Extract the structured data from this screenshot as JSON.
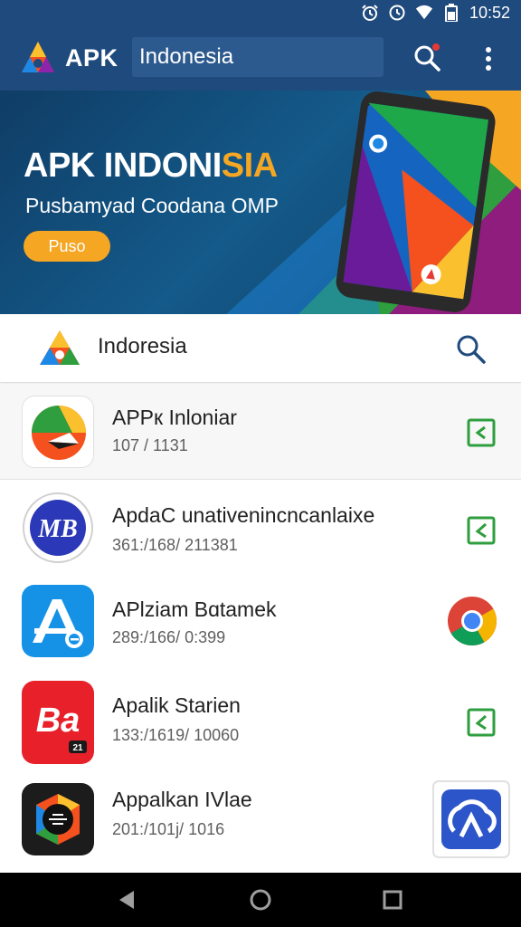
{
  "status_bar": {
    "time": "10:52",
    "icons": [
      "alarm-icon",
      "clock-icon",
      "wifi-icon",
      "battery-icon"
    ]
  },
  "app_bar": {
    "title": "APK",
    "search_text": "Indonesia",
    "actions": [
      "search-icon",
      "more-vert-icon"
    ]
  },
  "banner": {
    "title_main": "APK INDONI",
    "title_highlight": "SIA",
    "subtitle": "Pusbamyad Coodana OMP",
    "button_label": "Puso"
  },
  "section": {
    "title": "Indoresia",
    "action": "search-icon"
  },
  "apps": [
    {
      "name": "APPк Inlonіar",
      "meta": "107 / 1131",
      "icon": "triangle-app-icon",
      "action": "install-check-icon"
    },
    {
      "name": "ApdaC unativenincncanlaixe",
      "meta": "361:/168/ 211381",
      "icon": "mb-app-icon",
      "action": "install-check-icon"
    },
    {
      "name": "APlzіam Bɑtamek",
      "meta": "289:/166/ 0:399",
      "icon": "ae-app-icon",
      "action": "chrome-icon"
    },
    {
      "name": "Apalik Starien",
      "meta": "133:/1619/ 10060",
      "icon": "ba-app-icon",
      "action": "install-check-icon"
    },
    {
      "name": "Appalkan IVlae",
      "meta": "201:/101j/ 1016",
      "icon": "dark-app-icon",
      "action": "cloud-app-icon"
    }
  ],
  "nav_bar": {
    "buttons": [
      "back-icon",
      "home-icon",
      "recents-icon"
    ]
  },
  "colors": {
    "app_bar": "#1f4a7d",
    "accent": "#f5a623",
    "check_green": "#2e9e3e"
  }
}
